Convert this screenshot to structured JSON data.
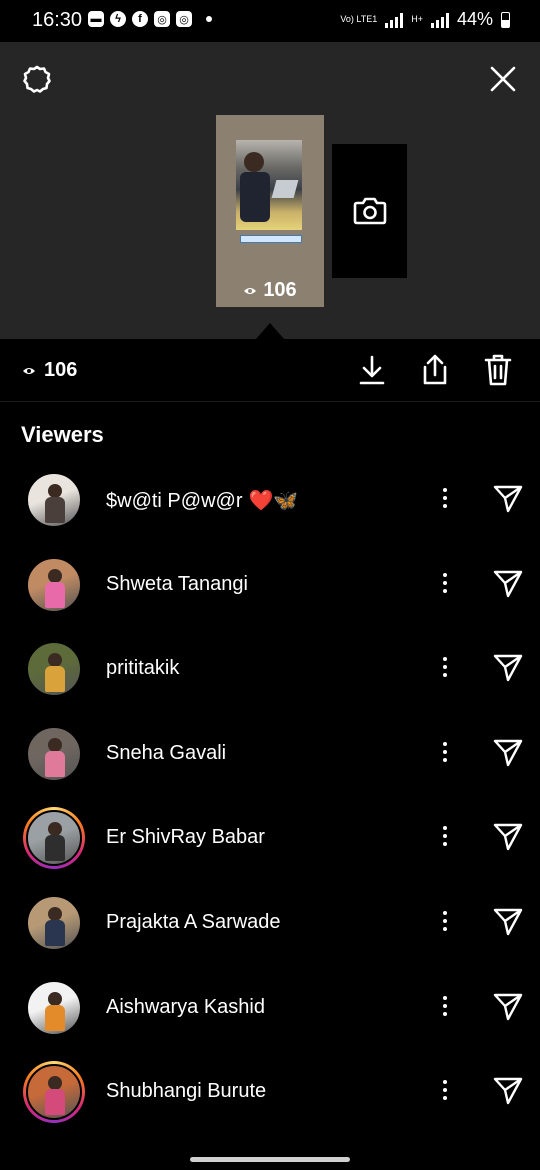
{
  "status_bar": {
    "time": "16:30",
    "network_label_1": "Vo) LTE1",
    "network_label_2": "H+",
    "battery": "44%",
    "icons": [
      "message-icon",
      "messenger-icon",
      "facebook-icon",
      "instagram-icon",
      "instagram-icon"
    ]
  },
  "story": {
    "views": "106",
    "thumbnail_caption": "INTERNSHIPSTUDIO.COM"
  },
  "actions": {
    "views": "106",
    "icons": [
      "download-icon",
      "share-icon",
      "delete-icon"
    ]
  },
  "viewers": {
    "title": "Viewers",
    "items": [
      {
        "name": "$w@ti   P@w@r",
        "emoji": "❤️🦋",
        "ring": false,
        "colors": [
          "#e9e4de",
          "#4a3f3a"
        ]
      },
      {
        "name": "Shweta Tanangi",
        "ring": false,
        "colors": [
          "#c08a63",
          "#e86aa8"
        ]
      },
      {
        "name": "prititakik",
        "ring": false,
        "colors": [
          "#5d6b3a",
          "#d9a23a"
        ]
      },
      {
        "name": "Sneha Gavali",
        "ring": false,
        "colors": [
          "#6f6660",
          "#e07a9a"
        ]
      },
      {
        "name": "Er ShivRay Babar",
        "ring": true,
        "colors": [
          "#9aa0a3",
          "#2e2e2e"
        ]
      },
      {
        "name": "Prajakta A Sarwade",
        "ring": false,
        "colors": [
          "#b79a75",
          "#2a3650"
        ]
      },
      {
        "name": "Aishwarya Kashid",
        "ring": false,
        "colors": [
          "#f2f2f2",
          "#e38a2a"
        ]
      },
      {
        "name": "Shubhangi Burute",
        "ring": true,
        "colors": [
          "#c76a3a",
          "#d44a7a"
        ]
      }
    ]
  }
}
